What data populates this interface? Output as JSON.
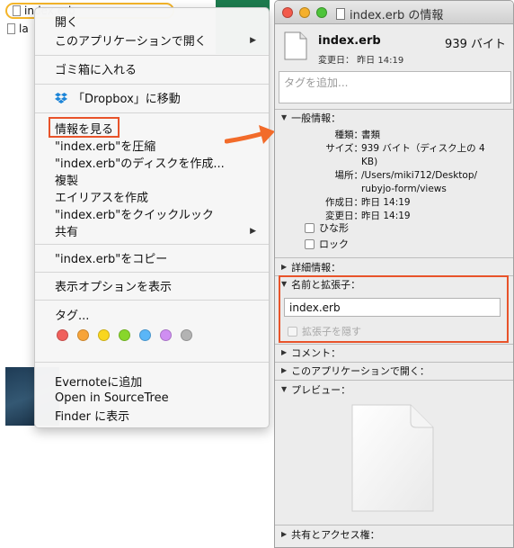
{
  "finder": {
    "files": [
      {
        "name": "index.erb"
      },
      {
        "name": "la"
      }
    ]
  },
  "context_menu": {
    "items": [
      {
        "label": "開く",
        "submenu": false
      },
      {
        "label": "このアプリケーションで開く",
        "submenu": true
      },
      {
        "label": "ゴミ箱に入れる",
        "submenu": false
      },
      {
        "label": "「Dropbox」に移動",
        "submenu": false,
        "icon": "dropbox-icon"
      },
      {
        "label": "情報を見る",
        "submenu": false,
        "highlighted": true
      },
      {
        "label": "\"index.erb\"を圧縮",
        "submenu": false
      },
      {
        "label": "\"index.erb\"のディスクを作成...",
        "submenu": false
      },
      {
        "label": "複製",
        "submenu": false
      },
      {
        "label": "エイリアスを作成",
        "submenu": false
      },
      {
        "label": "\"index.erb\"をクイックルック",
        "submenu": false
      },
      {
        "label": "共有",
        "submenu": true
      },
      {
        "label": "\"index.erb\"をコピー",
        "submenu": false
      },
      {
        "label": "表示オプションを表示",
        "submenu": false
      },
      {
        "label": "タグ...",
        "submenu": false
      },
      {
        "label": "Evernoteに追加",
        "submenu": false
      },
      {
        "label": "Open in SourceTree",
        "submenu": false
      },
      {
        "label": "Finder に表示",
        "submenu": false
      }
    ],
    "tag_colors": [
      "#f0605c",
      "#f7a43a",
      "#f9d61e",
      "#88d62b",
      "#5ab6f7",
      "#cf8ef2",
      "#b3b3b3"
    ]
  },
  "info_window": {
    "title": "index.erb の情報",
    "file_name": "index.erb",
    "file_size": "939 バイト",
    "modified_line": "変更日： 昨日 14:19",
    "tag_placeholder": "タグを追加...",
    "general": {
      "header": "一般情報：",
      "rows": [
        {
          "key": "種類：",
          "value": "書類"
        },
        {
          "key": "サイズ：",
          "value": "939 バイト（ディスク上の 4"
        },
        {
          "key": "",
          "value": "KB)"
        },
        {
          "key": "場所：",
          "value": "/Users/miki712/Desktop/"
        },
        {
          "key": "",
          "value": "rubyjo-form/views"
        },
        {
          "key": "作成日：",
          "value": "昨日 14:19"
        },
        {
          "key": "変更日：",
          "value": "昨日 14:19"
        }
      ],
      "stationery": "ひな形",
      "locked": "ロック"
    },
    "more_info": "詳細情報：",
    "name_ext": {
      "header": "名前と拡張子：",
      "value": "index.erb",
      "hide_extension": "拡張子を隠す"
    },
    "comments": "コメント：",
    "open_with": "このアプリケーションで開く：",
    "preview": "プレビュー：",
    "sharing": "共有とアクセス権："
  },
  "colors": {
    "highlight_red": "#e8532a",
    "selection_yellow": "#f4b52a"
  }
}
